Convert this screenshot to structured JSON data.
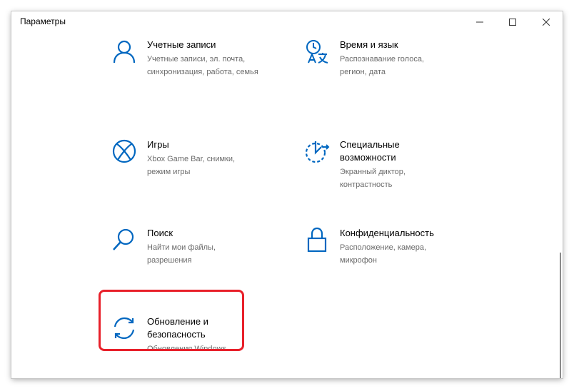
{
  "window": {
    "title": "Параметры",
    "controls": {
      "minimize": "minimize-icon",
      "maximize": "maximize-icon",
      "close": "close-icon"
    }
  },
  "accent_color": "#0067c0",
  "highlight_color": "#e8202a",
  "tiles": [
    {
      "name": "Учетные записи",
      "desc": [
        "Учетные записи, эл. почта,",
        "синхронизация, работа, семья"
      ],
      "icon": "person-icon"
    },
    {
      "name": "Время и язык",
      "desc": [
        "Распознавание голоса,",
        "регион, дата"
      ],
      "icon": "time-language-icon"
    },
    {
      "name": "Игры",
      "desc": [
        "Xbox Game Bar, снимки,",
        "режим игры"
      ],
      "icon": "xbox-icon"
    },
    {
      "name": [
        "Специальные",
        "возможности"
      ],
      "desc": [
        "Экранный диктор,",
        "контрастность"
      ],
      "icon": "ease-of-access-icon"
    },
    {
      "name": "Поиск",
      "desc": [
        "Найти мои файлы,",
        "разрешения"
      ],
      "icon": "search-icon"
    },
    {
      "name": "Конфиденциальность",
      "desc": [
        "Расположение, камера,",
        "микрофон"
      ],
      "icon": "lock-icon"
    },
    {
      "name": [
        "Обновление и",
        "безопасность"
      ],
      "desc": [
        "Обновления Windows"
      ],
      "icon": "sync-icon"
    }
  ]
}
